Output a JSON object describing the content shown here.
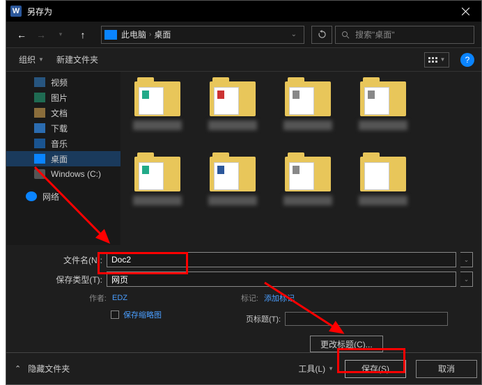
{
  "title": "另存为",
  "nav": {
    "pc": "此电脑",
    "desktop": "桌面",
    "search_placeholder": "搜索\"桌面\""
  },
  "toolbar": {
    "organize": "组织",
    "new_folder": "新建文件夹"
  },
  "sidebar": {
    "items": [
      {
        "label": "视频"
      },
      {
        "label": "图片"
      },
      {
        "label": "文档"
      },
      {
        "label": "下载"
      },
      {
        "label": "音乐"
      },
      {
        "label": "桌面"
      },
      {
        "label": "Windows (C:)"
      },
      {
        "label": "网络"
      }
    ]
  },
  "fields": {
    "filename_label": "文件名(N):",
    "filename_value": "Doc2",
    "filetype_label": "保存类型(T):",
    "filetype_value": "网页",
    "author_label": "作者:",
    "author_value": "EDZ",
    "tags_label": "标记:",
    "tags_value": "添加标记",
    "save_thumb": "保存缩略图",
    "page_title_label": "页标题(T):",
    "page_title_value": "",
    "change_title": "更改标题(C)..."
  },
  "footer": {
    "hide_folders": "隐藏文件夹",
    "tools": "工具(L)",
    "save": "保存(S)",
    "cancel": "取消"
  }
}
